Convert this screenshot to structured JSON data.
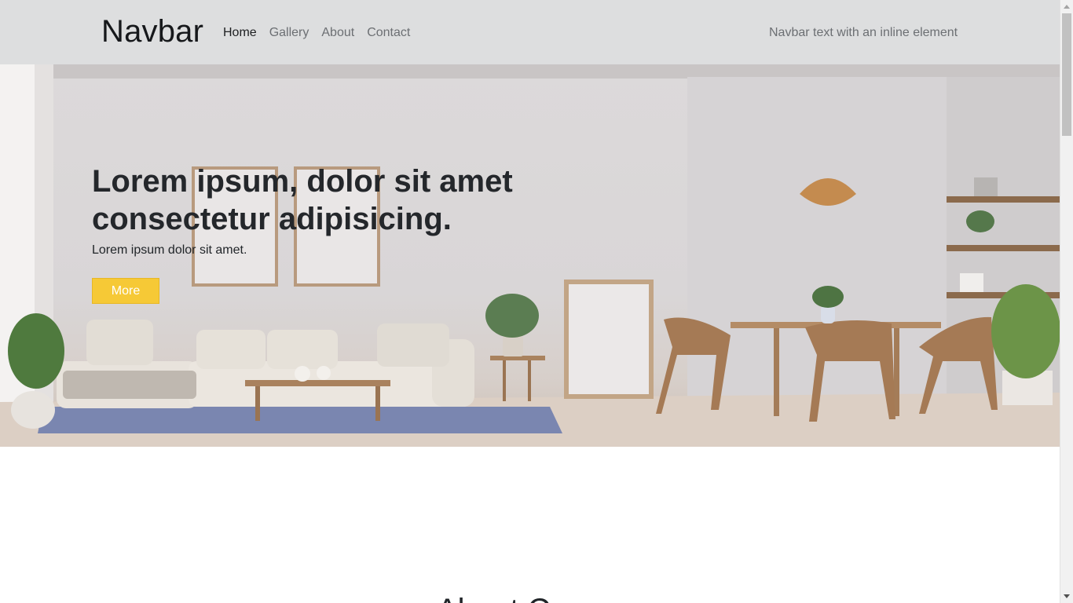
{
  "navbar": {
    "brand": "Navbar",
    "links": [
      {
        "label": "Home",
        "active": true
      },
      {
        "label": "Gallery",
        "active": false
      },
      {
        "label": "About",
        "active": false
      },
      {
        "label": "Contact",
        "active": false
      }
    ],
    "text": "Navbar text with an inline element"
  },
  "hero": {
    "title": "Lorem ipsum, dolor sit amet consectetur adipisicing.",
    "subtitle": "Lorem ipsum dolor sit amet.",
    "button_label": "More",
    "button_color": "#f6c936"
  },
  "about": {
    "heading": "About C..."
  },
  "icons": {
    "scroll_up": "triangle-up-icon",
    "scroll_down": "triangle-down-icon"
  }
}
